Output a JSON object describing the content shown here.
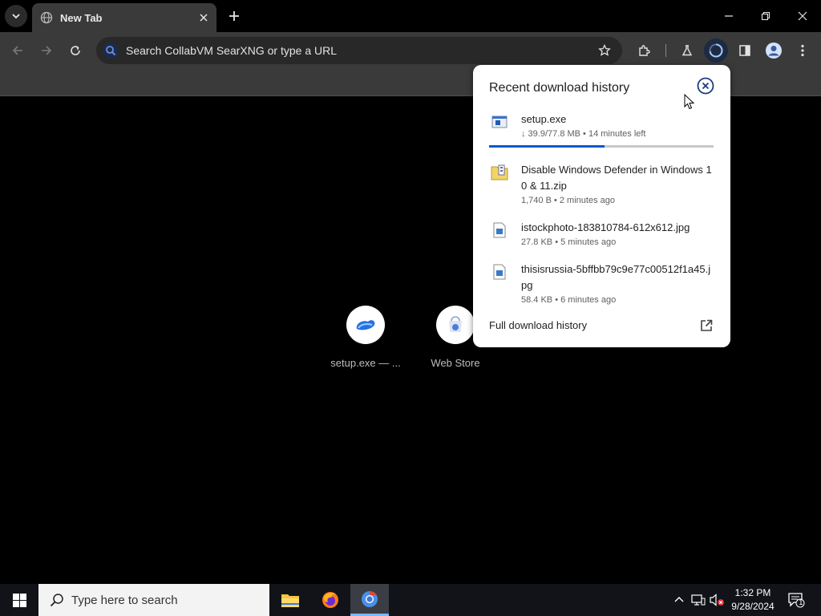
{
  "browser": {
    "tab_title": "New Tab",
    "omnibox_placeholder": "Search CollabVM SearXNG or type a URL"
  },
  "shortcuts": [
    {
      "label": "setup.exe — ..."
    },
    {
      "label": "Web Store"
    }
  ],
  "downloads": {
    "title": "Recent download history",
    "items": [
      {
        "name": "setup.exe",
        "meta": "↓ 39.9/77.8 MB • 14 minutes left",
        "progress": 0.513,
        "icon": "exe-icon"
      },
      {
        "name": "Disable Windows Defender in Windows 10 & 11.zip",
        "meta": "1,740 B • 2 minutes ago",
        "icon": "zip-icon"
      },
      {
        "name": "istockphoto-183810784-612x612.jpg",
        "meta": "27.8 KB • 5 minutes ago",
        "icon": "image-file-icon"
      },
      {
        "name": "thisisrussia-5bffbb79c9e77c00512f1a45.jpg",
        "meta": "58.4 KB • 6 minutes ago",
        "icon": "image-file-icon"
      }
    ],
    "footer": "Full download history"
  },
  "taskbar": {
    "search_placeholder": "Type here to search",
    "time": "1:32 PM",
    "date": "9/28/2024",
    "notification_count": "1"
  },
  "colors": {
    "accent": "#0b57d0",
    "toolbar": "#3a3a3a",
    "taskbar": "#111318"
  }
}
